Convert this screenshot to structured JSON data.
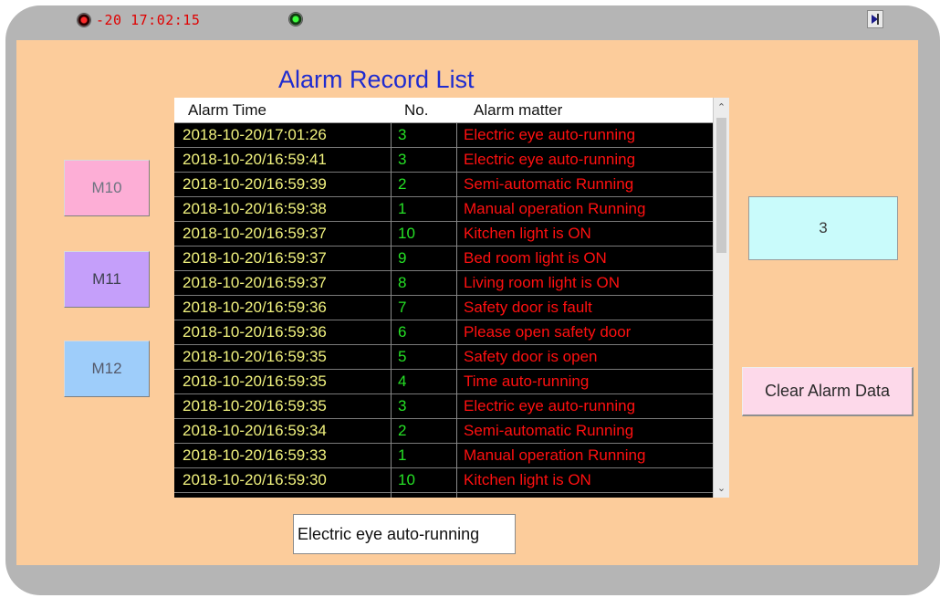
{
  "status_bar": {
    "clock_text": "-20 17:02:15"
  },
  "panel": {
    "title": "Alarm Record List"
  },
  "buttons": {
    "m10": "M10",
    "m11": "M11",
    "m12": "M12",
    "clear": "Clear Alarm Data"
  },
  "alarm_table": {
    "columns": [
      "Alarm Time",
      "No.",
      "Alarm matter"
    ],
    "rows": [
      {
        "time": "2018-10-20/17:01:26",
        "no": "3",
        "matter": "Electric eye auto-running"
      },
      {
        "time": "2018-10-20/16:59:41",
        "no": "3",
        "matter": "Electric eye auto-running"
      },
      {
        "time": "2018-10-20/16:59:39",
        "no": "2",
        "matter": "Semi-automatic Running"
      },
      {
        "time": "2018-10-20/16:59:38",
        "no": "1",
        "matter": "Manual operation Running"
      },
      {
        "time": "2018-10-20/16:59:37",
        "no": "10",
        "matter": "Kitchen light is ON"
      },
      {
        "time": "2018-10-20/16:59:37",
        "no": "9",
        "matter": "Bed room light is ON"
      },
      {
        "time": "2018-10-20/16:59:37",
        "no": "8",
        "matter": "Living room light is ON"
      },
      {
        "time": "2018-10-20/16:59:36",
        "no": "7",
        "matter": "Safety door is fault"
      },
      {
        "time": "2018-10-20/16:59:36",
        "no": "6",
        "matter": "Please open safety door"
      },
      {
        "time": "2018-10-20/16:59:35",
        "no": "5",
        "matter": "Safety door is open"
      },
      {
        "time": "2018-10-20/16:59:35",
        "no": "4",
        "matter": "Time auto-running"
      },
      {
        "time": "2018-10-20/16:59:35",
        "no": "3",
        "matter": "Electric eye auto-running"
      },
      {
        "time": "2018-10-20/16:59:34",
        "no": "2",
        "matter": "Semi-automatic Running"
      },
      {
        "time": "2018-10-20/16:59:33",
        "no": "1",
        "matter": "Manual operation Running"
      },
      {
        "time": "2018-10-20/16:59:30",
        "no": "10",
        "matter": "Kitchen light is ON"
      }
    ]
  },
  "alarm_count": "3",
  "selected_matter": "Electric eye auto-running",
  "colors": {
    "frame": "#b5b5b5",
    "panel": "#fccc9b",
    "title": "#1e2bd0",
    "time_text": "#f1f27e",
    "no_text": "#25e025",
    "matter_text": "#ff1010"
  },
  "icons": [
    "status-led-red-icon",
    "status-led-green-icon",
    "exit-icon",
    "scroll-up-arrow-icon",
    "scroll-down-arrow-icon"
  ]
}
